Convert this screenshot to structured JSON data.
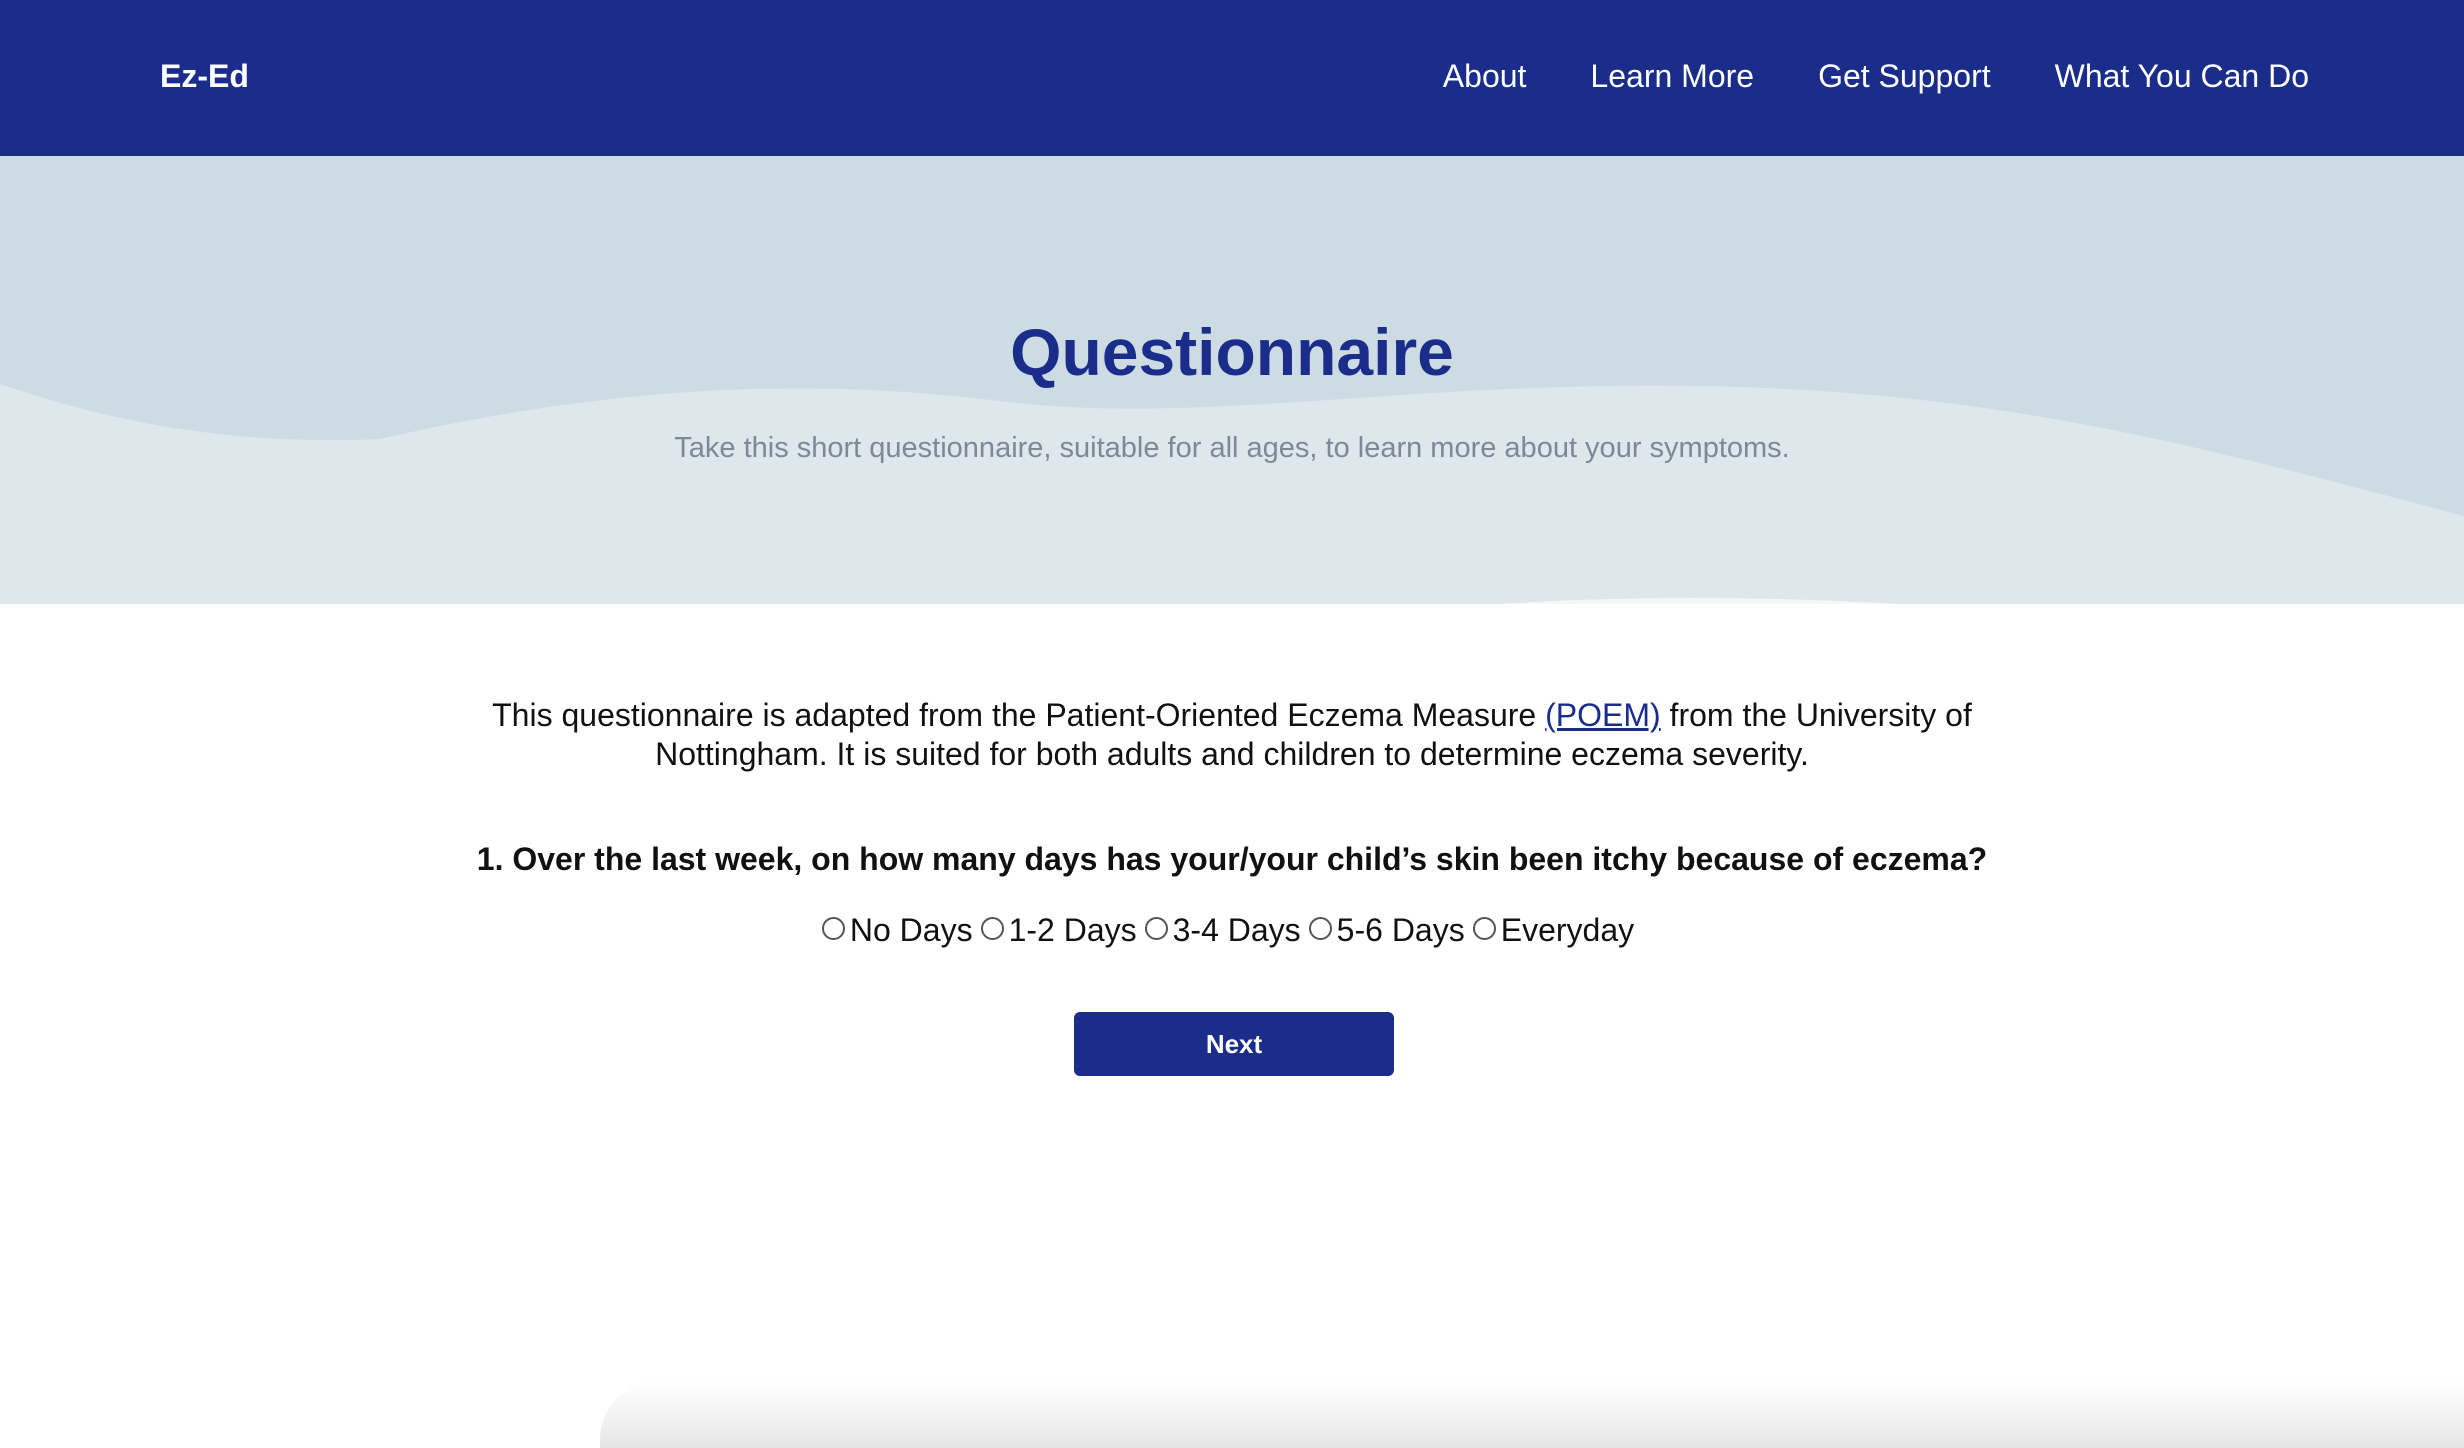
{
  "nav": {
    "brand": "Ez-Ed",
    "links": [
      "About",
      "Learn More",
      "Get Support",
      "What You Can Do"
    ]
  },
  "hero": {
    "title": "Questionnaire",
    "subtitle": "Take this short questionnaire, suitable for all ages, to learn more about your symptoms."
  },
  "intro": {
    "text_before": "This questionnaire is adapted from the Patient-Oriented Eczema Measure ",
    "link_text": "(POEM)",
    "text_after": " from the University of Nottingham. It is suited for both adults and children to determine eczema severity."
  },
  "question": {
    "text": "1. Over the last week, on how many days has your/your child’s skin been itchy because of eczema?",
    "options": [
      "No Days",
      "1-2 Days",
      "3-4 Days",
      "5-6 Days",
      "Everyday"
    ],
    "selected": null
  },
  "actions": {
    "next_label": "Next"
  },
  "colors": {
    "primary": "#1a2d8b",
    "hero_bg": "#dde7ec",
    "hero_wave": "#cddbe3",
    "subtitle": "#7b8a96"
  }
}
